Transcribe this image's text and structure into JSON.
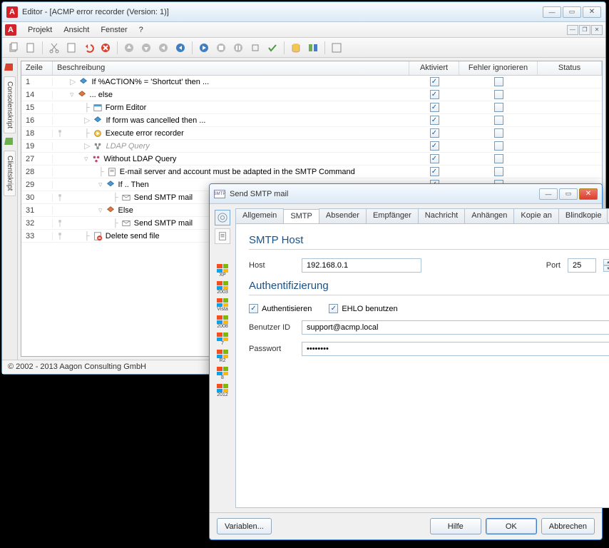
{
  "main": {
    "title": "Editor - [ACMP error recorder (Version: 1)]",
    "menu": [
      "Projekt",
      "Ansicht",
      "Fenster",
      "?"
    ],
    "side_tabs": [
      "Consolenskript",
      "Clientskript"
    ],
    "columns": {
      "zeile": "Zeile",
      "besch": "Beschreibung",
      "akt": "Aktiviert",
      "fehl": "Fehler ignorieren",
      "stat": "Status"
    },
    "rows": [
      {
        "n": "1",
        "indent": 0,
        "tw": "▷",
        "ico": "if",
        "text": "If %ACTION% = 'Shortcut' then ...",
        "akt": true
      },
      {
        "n": "14",
        "indent": 0,
        "tw": "▿",
        "ico": "else",
        "text": "... else",
        "akt": true
      },
      {
        "n": "15",
        "indent": 1,
        "tw": "",
        "ico": "form",
        "text": "Form Editor",
        "akt": true
      },
      {
        "n": "16",
        "indent": 1,
        "tw": "▷",
        "ico": "if",
        "text": "If form was cancelled then ...",
        "akt": true
      },
      {
        "n": "18",
        "indent": 1,
        "tw": "",
        "ico": "exec",
        "text": "Execute error recorder",
        "akt": true,
        "guide": true
      },
      {
        "n": "19",
        "indent": 1,
        "tw": "▷",
        "ico": "ldap",
        "text": "LDAP Query",
        "muted": true,
        "akt": true
      },
      {
        "n": "27",
        "indent": 1,
        "tw": "▿",
        "ico": "ldap2",
        "text": "Without LDAP Query",
        "akt": true
      },
      {
        "n": "28",
        "indent": 2,
        "tw": "",
        "ico": "note",
        "text": "E-mail server and account must be adapted in the SMTP Command",
        "akt": true
      },
      {
        "n": "29",
        "indent": 2,
        "tw": "▿",
        "ico": "if",
        "text": "If .. Then",
        "akt": true
      },
      {
        "n": "30",
        "indent": 3,
        "tw": "",
        "ico": "smtp",
        "text": "Send SMTP mail",
        "akt": true,
        "guide": true
      },
      {
        "n": "31",
        "indent": 2,
        "tw": "▿",
        "ico": "else",
        "text": "Else",
        "akt": true
      },
      {
        "n": "32",
        "indent": 3,
        "tw": "",
        "ico": "smtp",
        "text": "Send SMTP mail",
        "akt": true,
        "guide": true
      },
      {
        "n": "33",
        "indent": 1,
        "tw": "",
        "ico": "del",
        "text": "Delete send file",
        "akt": true,
        "guide": true
      }
    ],
    "footer": "© 2002 - 2013 Aagon Consulting GmbH"
  },
  "dlg": {
    "title": "Send SMTP mail",
    "tabs": [
      "Allgemein",
      "SMTP",
      "Absender",
      "Empfänger",
      "Nachricht",
      "Anhängen",
      "Kopie an",
      "Blindkopie",
      "A"
    ],
    "active_tab": 1,
    "os_labels": [
      "XP",
      "2003",
      "Vista",
      "2008",
      "7",
      "R2",
      "8",
      "2012"
    ],
    "smtp": {
      "section_host": "SMTP Host",
      "host_label": "Host",
      "host_value": "192.168.0.1",
      "port_label": "Port",
      "port_value": "25",
      "section_auth": "Authentifizierung",
      "chk_auth": "Authentisieren",
      "chk_ehlo": "EHLO benutzen",
      "user_label": "Benutzer ID",
      "user_value": "support@acmp.local",
      "pass_label": "Passwort",
      "pass_value": "••••••••"
    },
    "buttons": {
      "vars": "Variablen...",
      "help": "Hilfe",
      "ok": "OK",
      "cancel": "Abbrechen"
    }
  }
}
